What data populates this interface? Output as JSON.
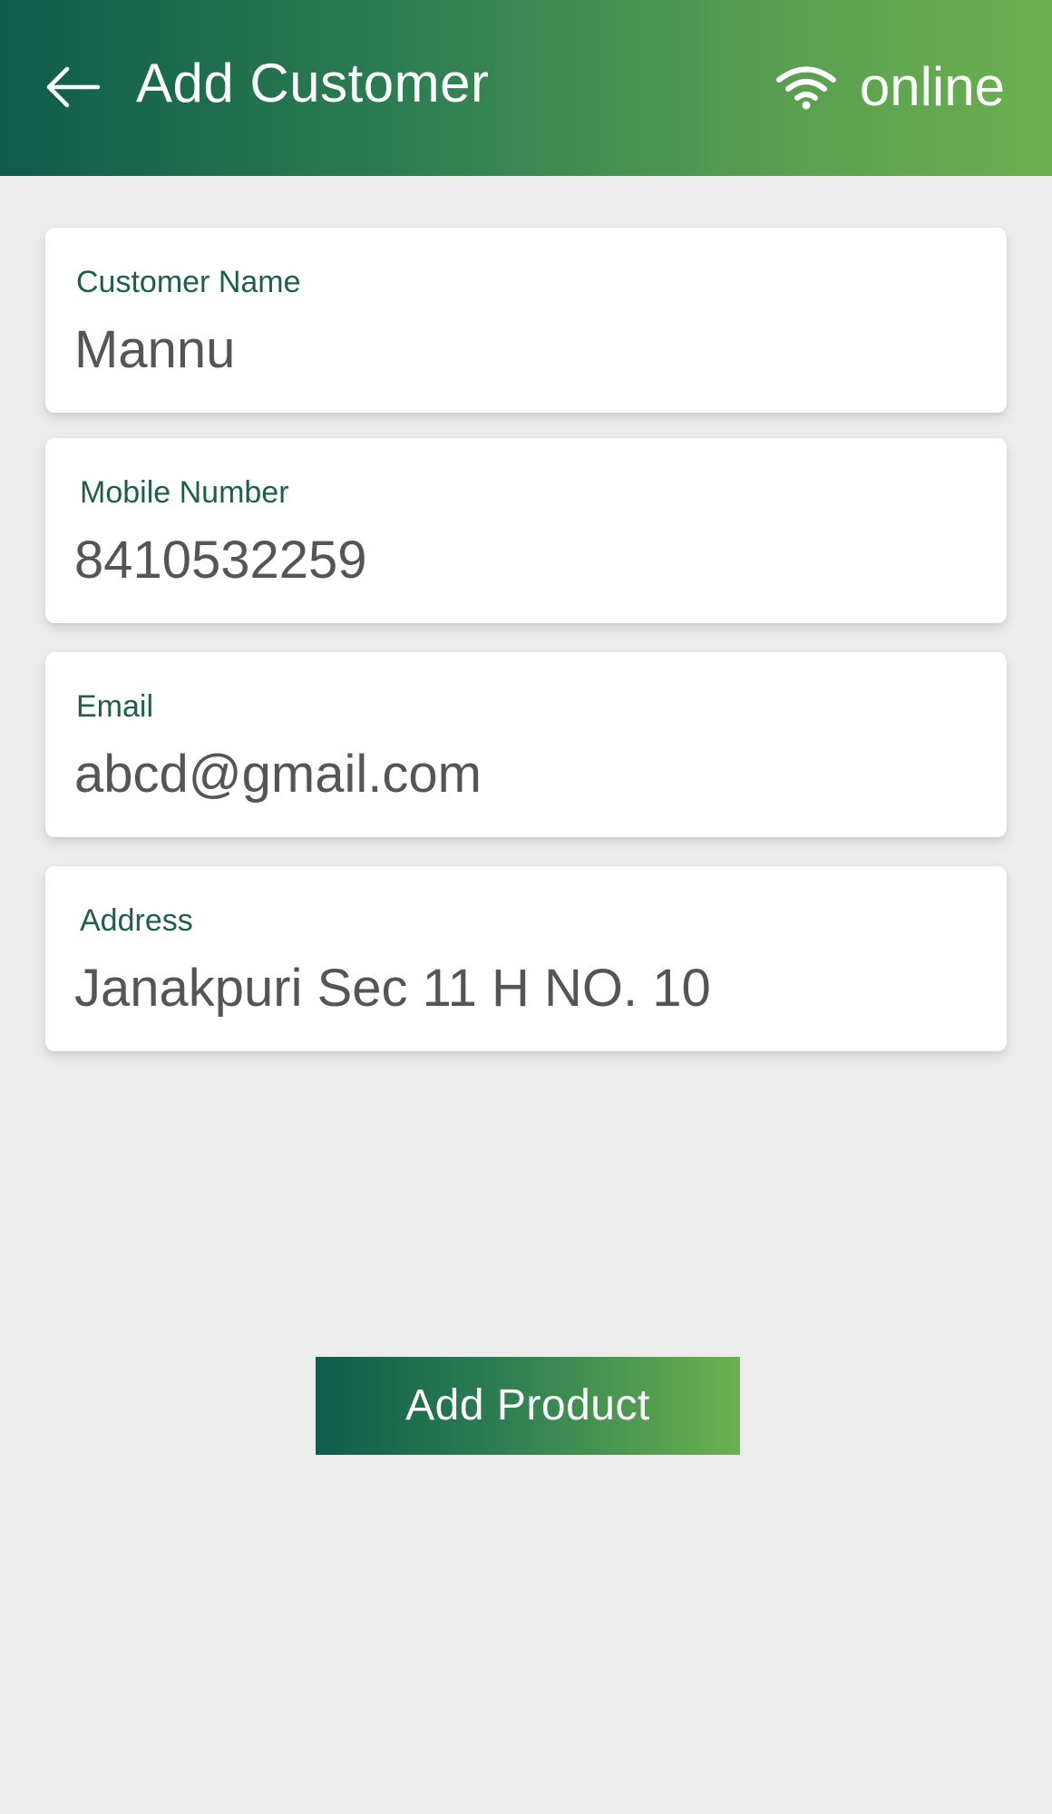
{
  "header": {
    "back_icon": "arrow-left-icon",
    "title": "Add Customer",
    "status_icon": "wifi-icon",
    "status_text": "online"
  },
  "form": {
    "customer_name": {
      "label": "Customer Name",
      "value": "Mannu"
    },
    "mobile_number": {
      "label": "Mobile Number",
      "value": "8410532259"
    },
    "email": {
      "label": "Email",
      "value": "abcd@gmail.com"
    },
    "address": {
      "label": "Address",
      "value": "Janakpuri Sec 11 H NO. 10"
    }
  },
  "actions": {
    "add_product_label": "Add Product"
  },
  "colors": {
    "header_start": "#0e5c4a",
    "header_end": "#6bb050",
    "label": "#1f5e4b",
    "value": "#555555",
    "background": "#ececec"
  }
}
